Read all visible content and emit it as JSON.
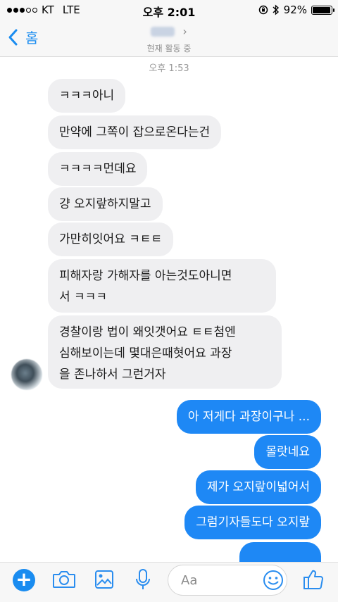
{
  "status_bar": {
    "carrier": "KT",
    "network": "LTE",
    "time": "오후 2:01",
    "battery": "92%",
    "signal_bars_filled": 3,
    "signal_bars_total": 5
  },
  "header": {
    "back_label": "홈",
    "contact_status": "현재 활동 중"
  },
  "chat": {
    "timestamp": "오후 1:53",
    "messages": [
      {
        "direction": "in",
        "text": "ㅋㅋㅋ아니"
      },
      {
        "direction": "in",
        "text": "만약에 그쪽이 잡으로온다는건"
      },
      {
        "direction": "in",
        "text": "ㅋㅋㅋㅋ먼데요"
      },
      {
        "direction": "in",
        "text": "걍 오지랖하지말고"
      },
      {
        "direction": "in",
        "text": "가만히잇어요 ㅋㅌㅌ"
      },
      {
        "direction": "in",
        "lines": [
          "피해자랑 가해자를 아는것도아니면",
          "서 ㅋㅋㅋ"
        ]
      },
      {
        "direction": "in",
        "lines": [
          "경찰이랑 법이 왜잇갯어요 ㅌㅌ첨엔",
          "심해보이는데 몇대은때혓어요 과장",
          "을 존나하서 그런거자"
        ]
      },
      {
        "direction": "out",
        "text": "아 저게다 과장이구나 ..."
      },
      {
        "direction": "out",
        "text": "몰랏네요"
      },
      {
        "direction": "out",
        "text": "제가 오지랖이넓어서"
      },
      {
        "direction": "out",
        "text": "그럼기자들도다 오지랖"
      }
    ]
  },
  "composer": {
    "placeholder": "Aa"
  },
  "colors": {
    "accent": "#1a8cf0",
    "outgoing_bubble": "#1e88f5",
    "incoming_bubble": "#efeff1"
  },
  "icons": [
    "plus-icon",
    "camera-icon",
    "image-icon",
    "microphone-icon",
    "emoji-icon",
    "thumbs-up-icon",
    "back-chevron-icon",
    "bluetooth-icon",
    "rotation-lock-icon"
  ]
}
